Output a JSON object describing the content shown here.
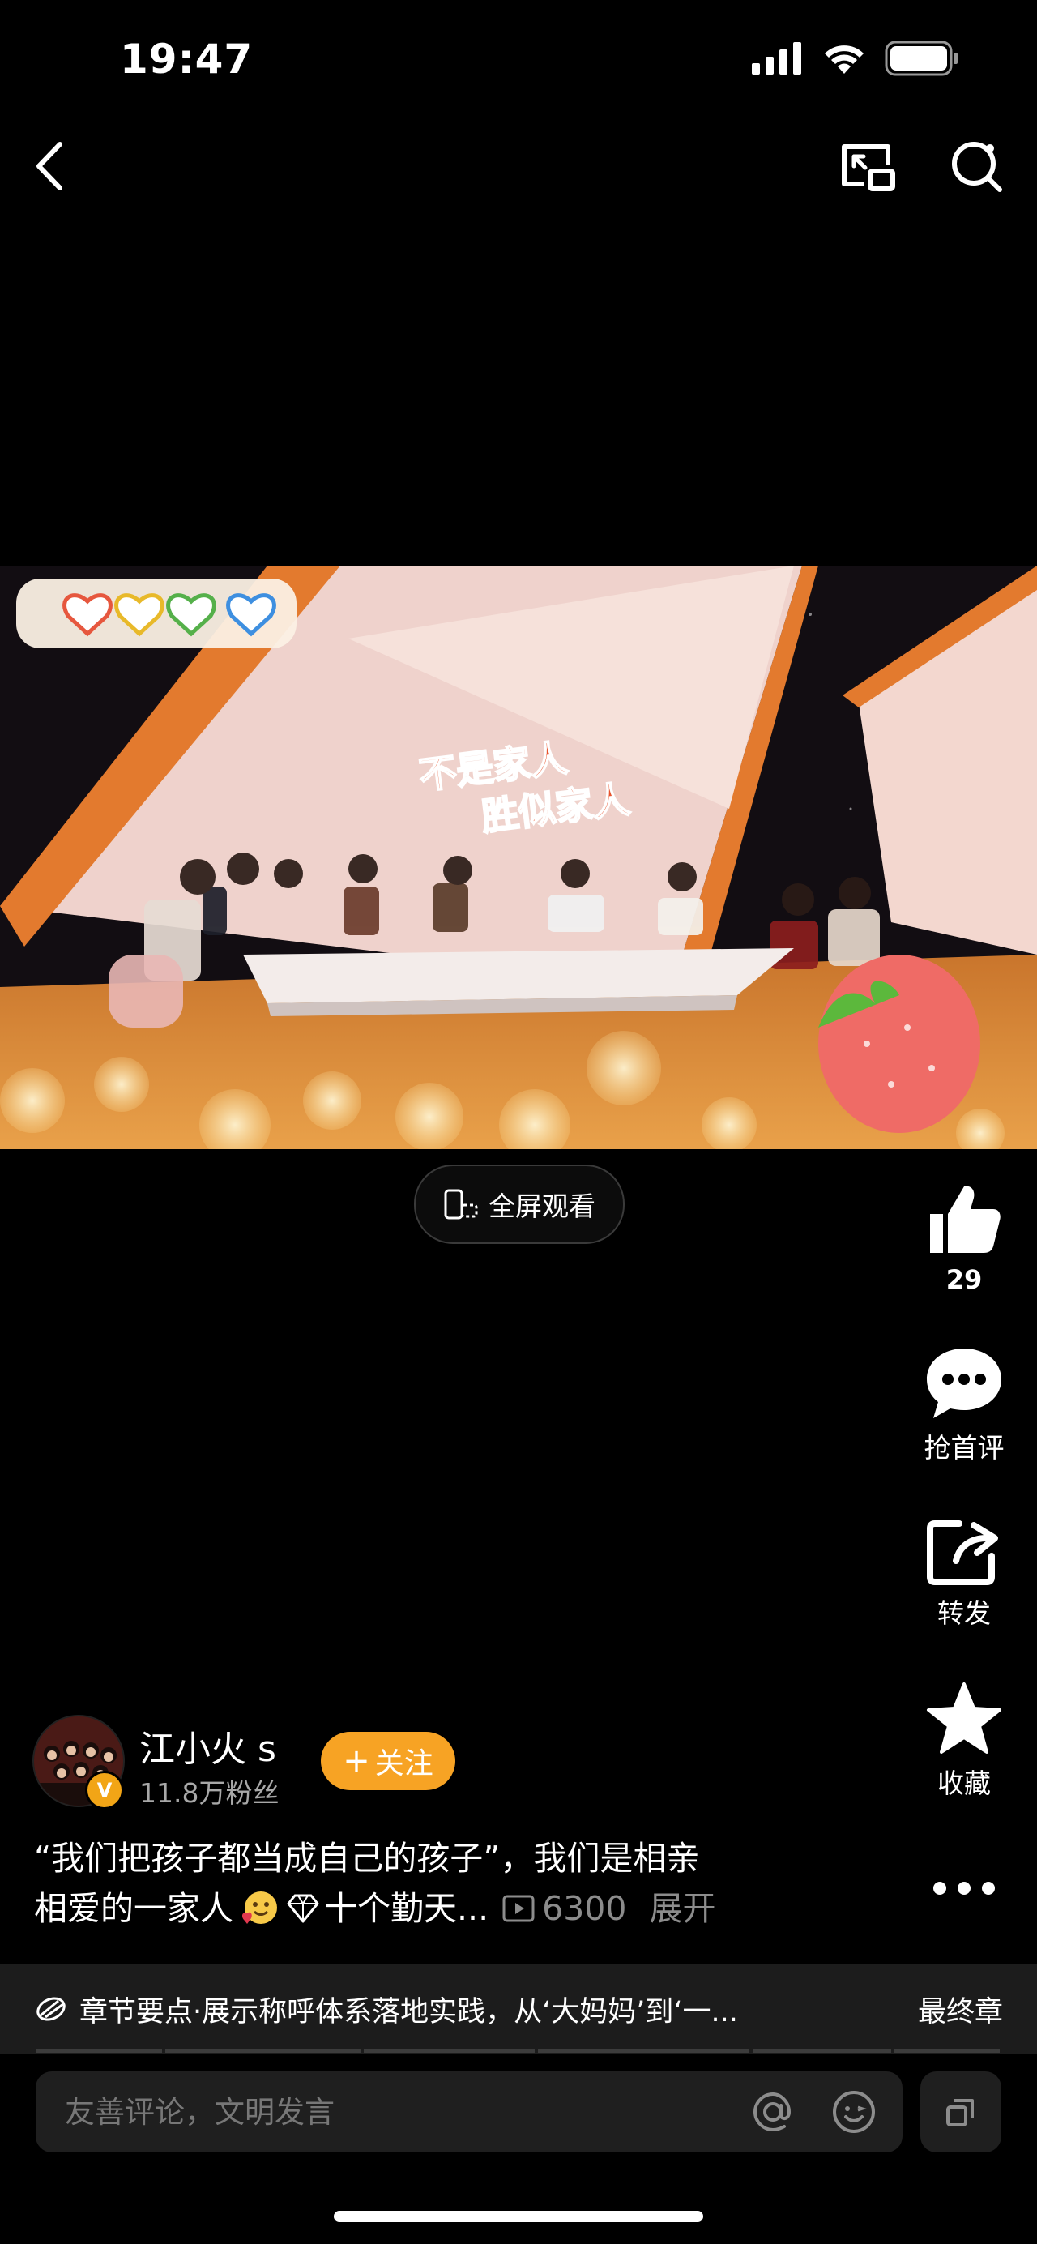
{
  "status_bar": {
    "time": "19:47"
  },
  "video": {
    "caption_line1": "不是家人",
    "caption_line2": "胜似家人",
    "fullscreen_label": "全屏观看"
  },
  "actions": {
    "like_count": "29",
    "comment_label": "抢首评",
    "share_label": "转发",
    "favorite_label": "收藏"
  },
  "author": {
    "name": "江小火 s",
    "fans": "11.8万粉丝",
    "follow_label": "关注"
  },
  "description": {
    "text_line1": "“我们把孩子都当成自己的孩子”，我们是相亲",
    "text_line2": "相爱的一家人",
    "text_line2_tail": "十个勤天...",
    "views": "6300",
    "expand_label": "展开"
  },
  "chapter": {
    "text": "章节要点·展示称呼体系落地实践，从‘大妈妈’到‘一...",
    "final_label": "最终章",
    "progress_segments": 6
  },
  "comment": {
    "placeholder": "友善评论，文明发言"
  },
  "colors": {
    "accent": "#f7a324",
    "background": "#000000"
  }
}
